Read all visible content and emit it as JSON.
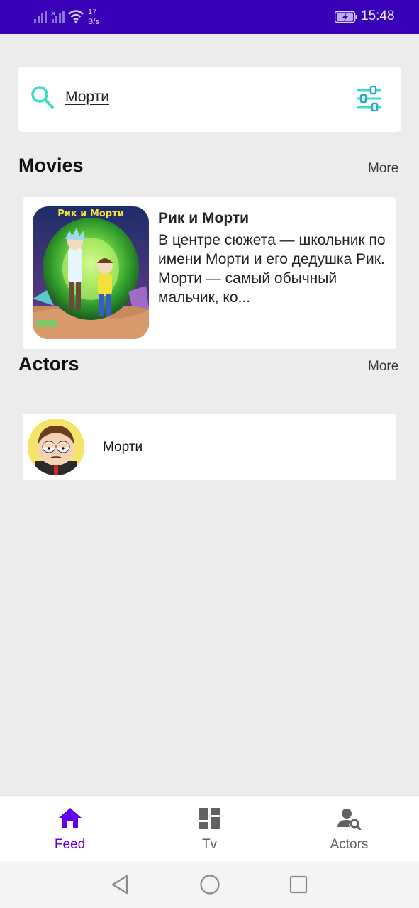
{
  "status_bar": {
    "net_speed_value": "17",
    "net_speed_unit": "B/s",
    "time": "15:48"
  },
  "search": {
    "query": "Морти",
    "icons": {
      "search": "search-icon",
      "filter": "tune-sliders-icon"
    }
  },
  "movies_section": {
    "title": "Movies",
    "more_label": "More",
    "items": [
      {
        "title": "Рик и Морти",
        "description": "В центре сюжета — школьник по имени Морти и его дедушка Рик. Морти — самый обычный мальчик, ко...",
        "poster_text": "Рик и Морти"
      }
    ]
  },
  "actors_section": {
    "title": "Actors",
    "more_label": "More",
    "items": [
      {
        "name": "Морти"
      }
    ]
  },
  "bottom_nav": {
    "items": [
      {
        "label": "Feed",
        "icon": "home-icon",
        "active": true
      },
      {
        "label": "Tv",
        "icon": "dashboard-icon",
        "active": false
      },
      {
        "label": "Actors",
        "icon": "person-search-icon",
        "active": false
      }
    ]
  },
  "colors": {
    "status_bar": "#3a00b8",
    "accent": "#6200ee",
    "teal": "#3ddcc4",
    "background": "#ececec",
    "inactive_nav": "#616161"
  }
}
